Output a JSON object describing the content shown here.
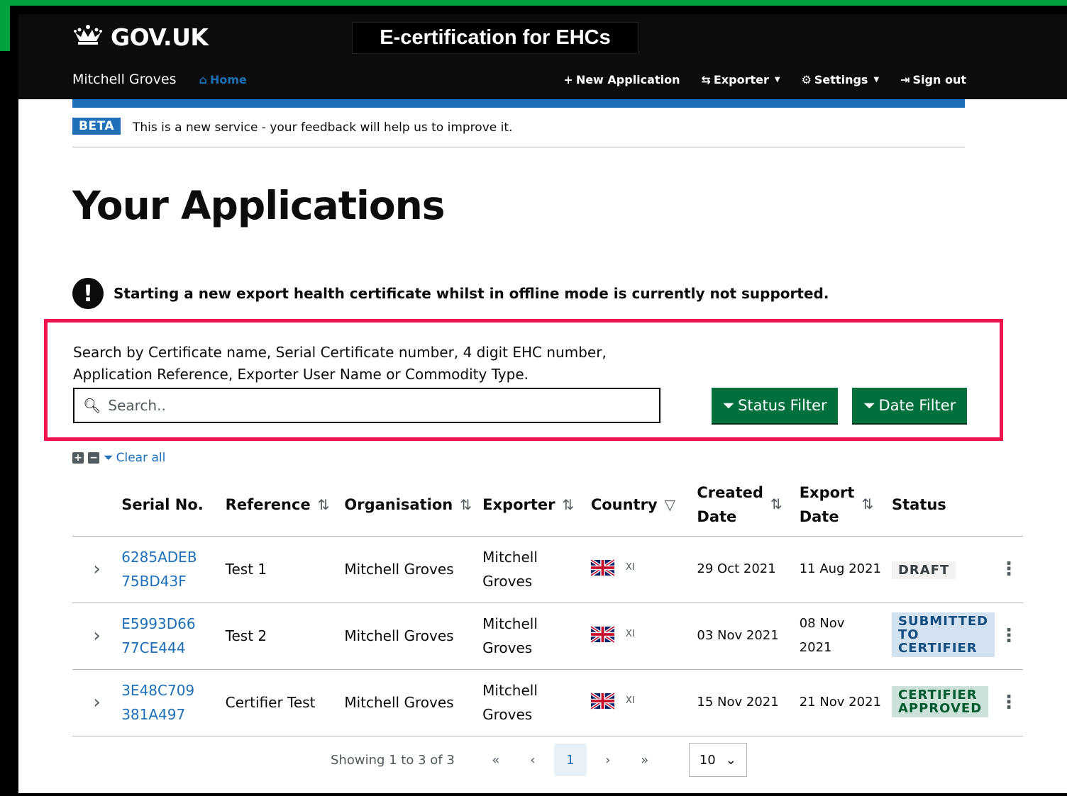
{
  "colors": {
    "header_bg": "#0b0c0c",
    "accent_blue": "#1d70b8",
    "button_green": "#00703c",
    "highlight_red": "#f0134d",
    "corner_green": "#00a33b"
  },
  "header": {
    "logo_text": "GOV.UK",
    "logo_icon": "crown-icon",
    "service_title": "E-certification for EHCs",
    "user_name": "Mitchell Groves",
    "home_label": "Home",
    "nav": {
      "new_application": "New Application",
      "exporter": "Exporter",
      "settings": "Settings",
      "sign_out": "Sign out"
    }
  },
  "beta": {
    "tag": "BETA",
    "text": "This is a new service - your feedback will help us to improve it."
  },
  "page_title": "Your Applications",
  "warning_text": "Starting a new export health certificate whilst in offline mode is currently not supported.",
  "search": {
    "hint": "Search by Certificate name, Serial Certificate number, 4 digit EHC number, Application Reference, Exporter User Name or Commodity Type.",
    "placeholder": "Search..",
    "status_filter": "Status Filter",
    "date_filter": "Date Filter"
  },
  "tools": {
    "clear_all": "Clear all"
  },
  "table": {
    "headers": {
      "serial": "Serial No.",
      "reference": "Reference",
      "organisation": "Organisation",
      "exporter": "Exporter",
      "country": "Country",
      "created_1": "Created",
      "created_2": "Date",
      "export_1": "Export",
      "export_2": "Date",
      "status": "Status"
    },
    "rows": [
      {
        "serial_1": "6285ADEB",
        "serial_2": "75BD43F",
        "reference": "Test 1",
        "organisation": "Mitchell Groves",
        "exporter_1": "Mitchell",
        "exporter_2": "Groves",
        "country_code": "XI",
        "created": "29 Oct 2021",
        "export_1": "11 Aug 2021",
        "export_2": "",
        "status_1": "DRAFT",
        "status_2": "",
        "status_3": ""
      },
      {
        "serial_1": "E5993D66",
        "serial_2": "77CE444",
        "reference": "Test 2",
        "organisation": "Mitchell Groves",
        "exporter_1": "Mitchell",
        "exporter_2": "Groves",
        "country_code": "XI",
        "created": "03 Nov 2021",
        "export_1": "08 Nov",
        "export_2": "2021",
        "status_1": "SUBMITTED",
        "status_2": "TO",
        "status_3": "CERTIFIER"
      },
      {
        "serial_1": "3E48C709",
        "serial_2": "381A497",
        "reference": "Certifier Test",
        "organisation": "Mitchell Groves",
        "exporter_1": "Mitchell",
        "exporter_2": "Groves",
        "country_code": "XI",
        "created": "15 Nov 2021",
        "export_1": "21 Nov 2021",
        "export_2": "",
        "status_1": "CERTIFIER",
        "status_2": "APPROVED",
        "status_3": ""
      }
    ]
  },
  "pagination": {
    "info": "Showing 1 to 3 of 3",
    "first": "«",
    "prev": "‹",
    "current": "1",
    "next": "›",
    "last": "»",
    "page_size": "10"
  }
}
